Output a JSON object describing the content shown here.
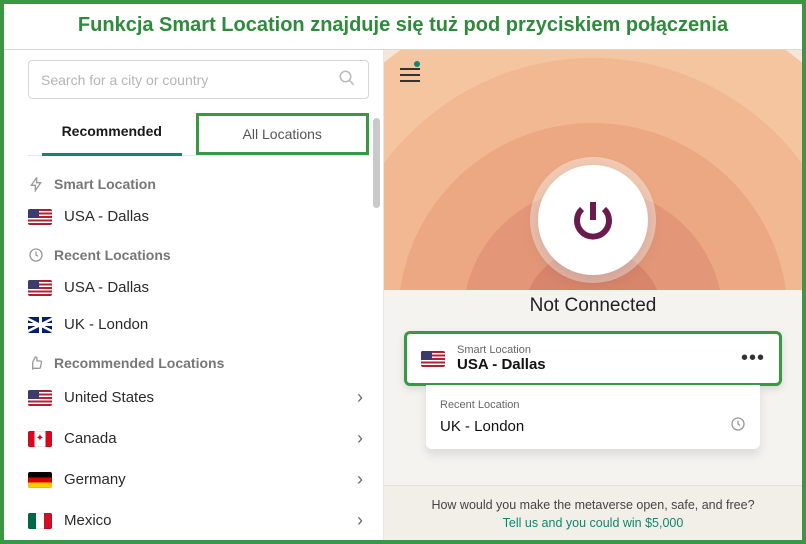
{
  "banner": {
    "text": "Funkcja Smart Location znajduje się tuż pod przyciskiem połączenia"
  },
  "search": {
    "placeholder": "Search for a city or country"
  },
  "tabs": {
    "recommended": "Recommended",
    "all": "All Locations"
  },
  "sections": {
    "smart": {
      "title": "Smart Location",
      "items": [
        {
          "label": "USA - Dallas"
        }
      ]
    },
    "recent": {
      "title": "Recent Locations",
      "items": [
        {
          "label": "USA - Dallas"
        },
        {
          "label": "UK - London"
        }
      ]
    },
    "recommended": {
      "title": "Recommended Locations",
      "items": [
        {
          "label": "United States"
        },
        {
          "label": "Canada"
        },
        {
          "label": "Germany"
        },
        {
          "label": "Mexico"
        }
      ]
    }
  },
  "connection": {
    "status": "Not Connected",
    "smart_label": "Smart Location",
    "smart_value": "USA - Dallas",
    "recent_label": "Recent Location",
    "recent_value": "UK - London"
  },
  "promo": {
    "line1": "How would you make the metaverse open, safe, and free?",
    "line2": "Tell us and you could win $5,000"
  }
}
